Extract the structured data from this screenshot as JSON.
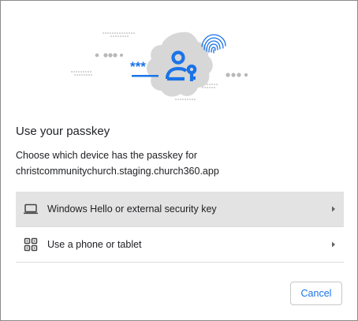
{
  "dialog": {
    "title": "Use your passkey",
    "description_line1": "Choose which device has the passkey for",
    "description_line2": "christcommunitychurch.staging.church360.app",
    "hero_text": "***"
  },
  "options": [
    {
      "label": "Windows Hello or external security key",
      "icon": "laptop-icon",
      "selected": true
    },
    {
      "label": "Use a phone or tablet",
      "icon": "qr-code-icon",
      "selected": false
    }
  ],
  "buttons": {
    "cancel_label": "Cancel"
  },
  "colors": {
    "accent": "#1a73e8",
    "hover_bg": "#e3e3e3",
    "blob": "#d7d7d7",
    "text": "#202124"
  }
}
